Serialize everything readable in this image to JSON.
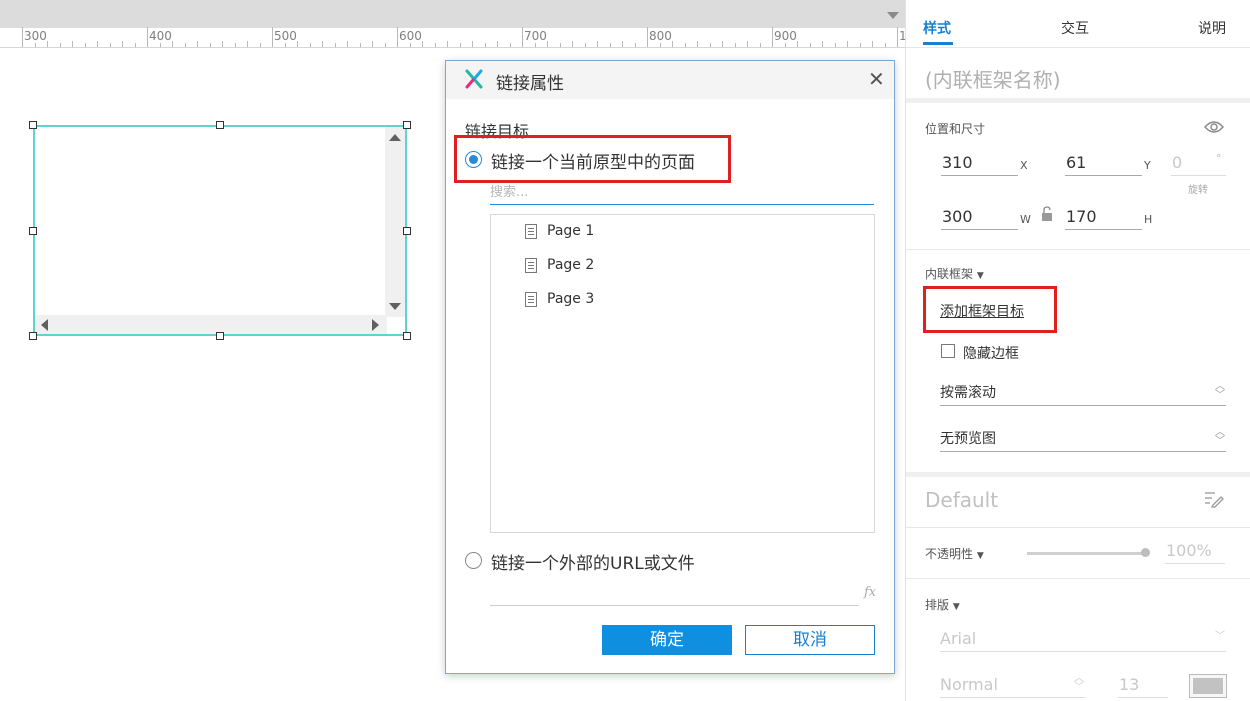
{
  "ruler": {
    "labels": [
      "300",
      "400",
      "500",
      "600",
      "700",
      "800",
      "900",
      "1"
    ]
  },
  "dialog": {
    "title": "链接属性",
    "close_glyph": "✕",
    "section_label": "链接目标",
    "option_page": "链接一个当前原型中的页面",
    "search_placeholder": "搜索...",
    "pages": [
      "Page 1",
      "Page 2",
      "Page 3"
    ],
    "option_url": "链接一个外部的URL或文件",
    "fx_label": "fx",
    "ok_label": "确定",
    "cancel_label": "取消",
    "logo_colors": [
      "#1ba7e8",
      "#e8297e",
      "#22b8a6"
    ]
  },
  "panel": {
    "tabs": {
      "style": "样式",
      "interact": "交互",
      "notes": "说明"
    },
    "placeholder_name": "(内联框架名称)",
    "position_size": {
      "label": "位置和尺寸",
      "x": "310",
      "x_axis": "X",
      "y": "61",
      "y_axis": "Y",
      "rotation": "0",
      "rotation_unit": "°",
      "rotation_label": "旋转",
      "w": "300",
      "w_axis": "W",
      "h": "170",
      "h_axis": "H"
    },
    "iframe": {
      "label": "内联框架",
      "add_target": "添加框架目标",
      "hide_border": "隐藏边框",
      "scrolling": "按需滚动",
      "preview": "无预览图"
    },
    "style_name": "Default",
    "opacity": {
      "label": "不透明性",
      "value": "100%",
      "level": 1.0
    },
    "typography": {
      "label": "排版",
      "font": "Arial",
      "weight": "Normal",
      "size": "13"
    },
    "accent_color": "#1a7fcf",
    "highlight_color": "#e02020"
  }
}
